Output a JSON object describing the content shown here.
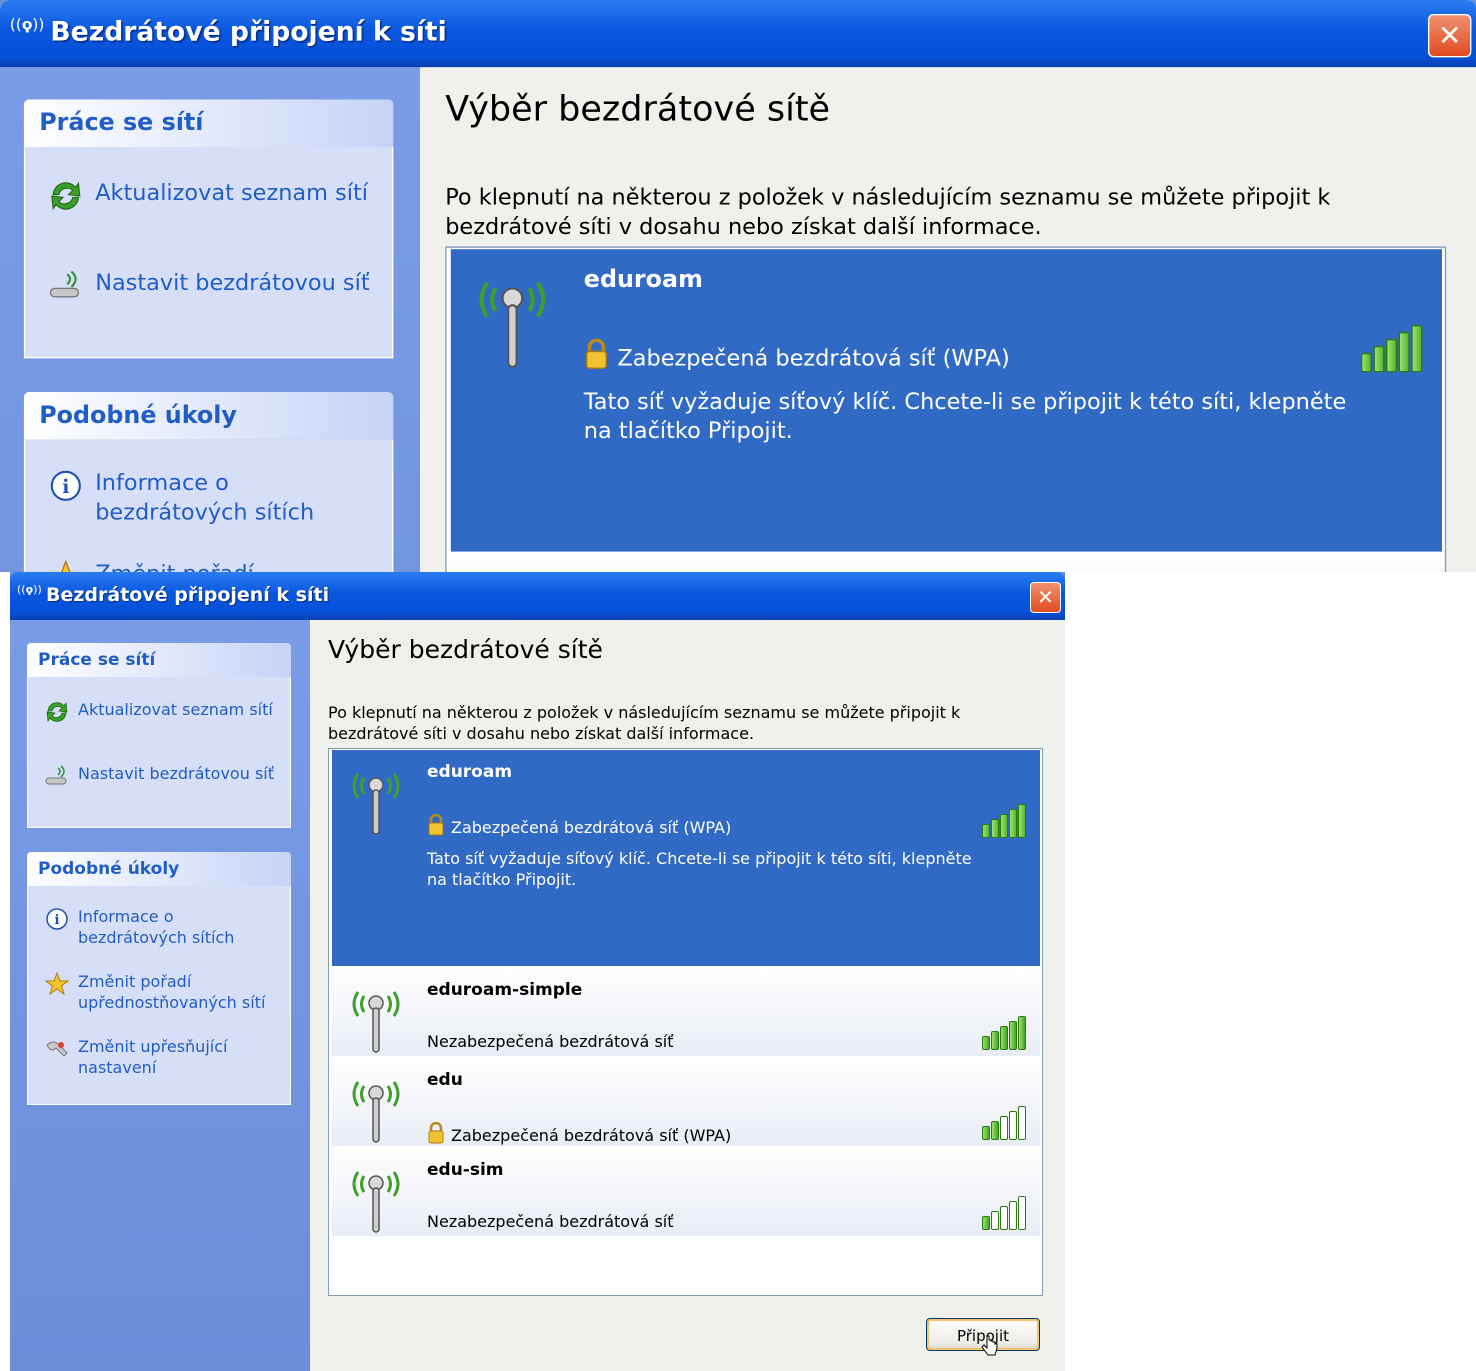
{
  "window": {
    "title": "Bezdrátové připojení k síti",
    "close_glyph": "✕"
  },
  "sidebar": {
    "network_tasks": {
      "header": "Práce se sítí",
      "items": [
        {
          "label": "Aktualizovat seznam sítí",
          "icon": "refresh-icon"
        },
        {
          "label": "Nastavit bezdrátovou síť",
          "icon": "wireless-setup-icon"
        }
      ]
    },
    "related_tasks": {
      "header": "Podobné úkoly",
      "items": [
        {
          "label": "Informace o bezdrátových sítích",
          "icon": "info-icon"
        },
        {
          "label": "Změnit pořadí upřednostňovaných sítí",
          "icon": "star-icon"
        },
        {
          "label": "Změnit upřesňující nastavení",
          "icon": "settings-icon"
        }
      ]
    }
  },
  "content": {
    "title": "Výběr bezdrátové sítě",
    "description": "Po klepnutí na některou z položek v následujícím seznamu se můžete připojit k bezdrátové síti v dosahu nebo získat další informace.",
    "networks": [
      {
        "name": "eduroam",
        "status": "Zabezpečená bezdrátová síť (WPA)",
        "secured": true,
        "selected": true,
        "signal": 1.0,
        "details": "Tato síť vyžaduje síťový klíč. Chcete-li se připojit k této síti, klepněte na tlačítko Připojit."
      },
      {
        "name": "eduroam-simple",
        "status": "Nezabezpečená bezdrátová síť",
        "secured": false,
        "selected": false,
        "signal": 1.0
      },
      {
        "name": "edu",
        "status": "Zabezpečená bezdrátová síť (WPA)",
        "secured": true,
        "selected": false,
        "signal": 0.4
      },
      {
        "name": "edu-sim",
        "status": "Nezabezpečená bezdrátová síť",
        "secured": false,
        "selected": false,
        "signal": 0.2
      }
    ],
    "connect_button": "Připojit"
  },
  "colors": {
    "titlebar": "#0a57df",
    "sidebar": "#6b8fd8",
    "selection": "#316ac5",
    "link": "#215dc6"
  }
}
